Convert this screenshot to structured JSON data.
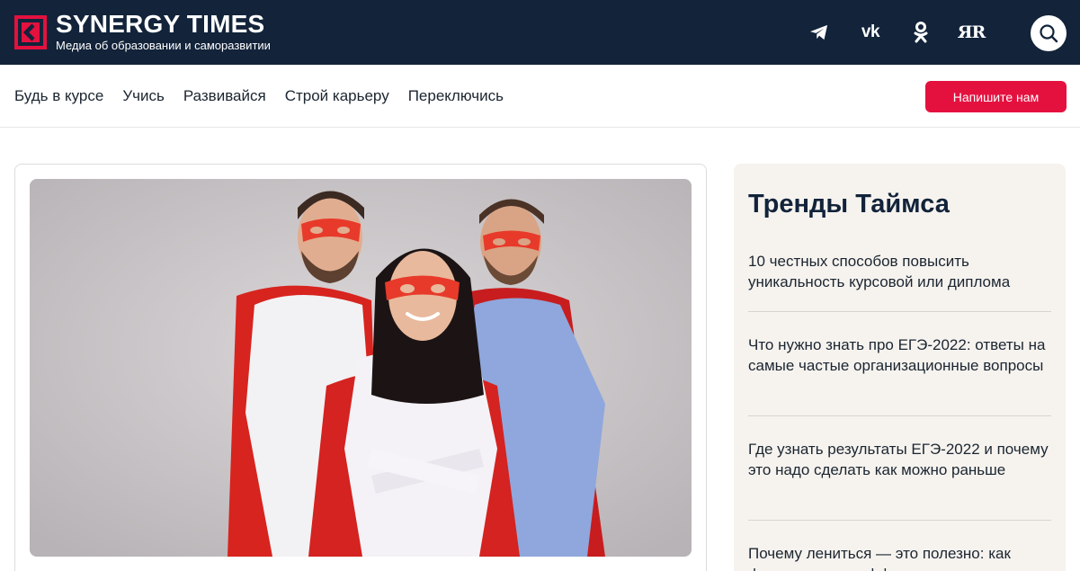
{
  "header": {
    "logo_title": "SYNERGY TIMES",
    "logo_subtitle": "Медиа об образовании и саморазвитии",
    "social": [
      {
        "name": "telegram",
        "icon": "telegram-icon"
      },
      {
        "name": "vk",
        "icon": "vk-icon",
        "text": "vk"
      },
      {
        "name": "odnoklassniki",
        "icon": "ok-icon"
      },
      {
        "name": "yandex-zen",
        "icon": "zen-icon",
        "text": "ЯR"
      }
    ],
    "search_icon": "search-icon"
  },
  "nav": {
    "items": [
      "Будь в курсе",
      "Учись",
      "Развивайся",
      "Строй карьеру",
      "Переключись"
    ],
    "cta_label": "Напишите нам"
  },
  "sidebar": {
    "title": "Тренды Таймса",
    "items": [
      "10 честных способов повысить уникальность курсовой или диплома",
      "Что нужно знать про ЕГЭ-2022: ответы на самые частые организационные вопросы",
      "Где узнать результаты ЕГЭ-2022 и почему это надо сделать как можно раньше",
      "Почему лениться — это полезно: как флоу помогает эффективности"
    ]
  },
  "colors": {
    "header_bg": "#12233a",
    "accent": "#e4113f",
    "sidebar_bg": "#f6f3ef"
  }
}
